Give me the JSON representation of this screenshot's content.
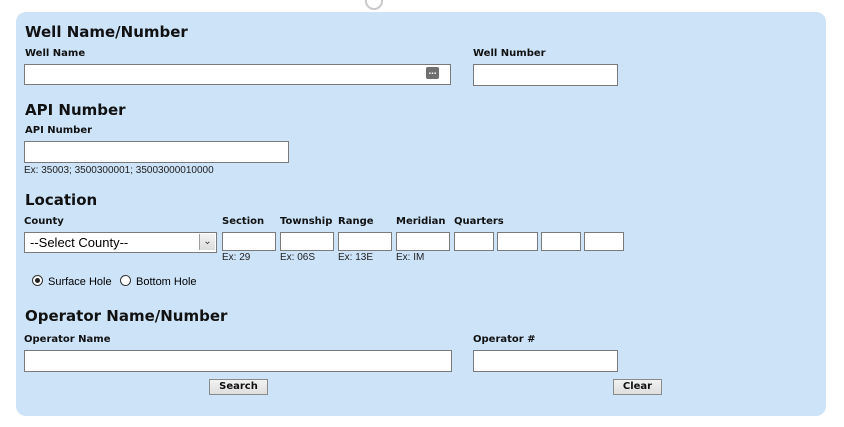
{
  "well_section": {
    "heading": "Well Name/Number",
    "well_name_label": "Well Name",
    "well_name_value": "",
    "lookup_glyph": "…",
    "well_number_label": "Well Number",
    "well_number_value": ""
  },
  "api_section": {
    "heading": "API Number",
    "api_label": "API Number",
    "api_value": "",
    "api_example": "Ex: 35003; 3500300001; 35003000010000"
  },
  "location_section": {
    "heading": "Location",
    "county_label": "County",
    "county_selected": "--Select County--",
    "section_label": "Section",
    "section_example": "Ex: 29",
    "township_label": "Township",
    "township_example": "Ex: 06S",
    "range_label": "Range",
    "range_example": "Ex: 13E",
    "meridian_label": "Meridian",
    "meridian_example": "Ex: IM",
    "quarters_label": "Quarters",
    "radio_surface_label": "Surface Hole",
    "radio_bottom_label": "Bottom Hole",
    "radio_selected": "Surface Hole"
  },
  "operator_section": {
    "heading": "Operator Name/Number",
    "operator_name_label": "Operator Name",
    "operator_name_value": "",
    "operator_number_label": "Operator #",
    "operator_number_value": ""
  },
  "buttons": {
    "search_label": "Search",
    "clear_label": "Clear"
  },
  "icons": {
    "lookup": "ellipsis-lookup-icon",
    "dropdown": "chevron-down-icon"
  },
  "colors": {
    "panel_background": "#cce3f8",
    "field_border": "#7a7a7a"
  }
}
